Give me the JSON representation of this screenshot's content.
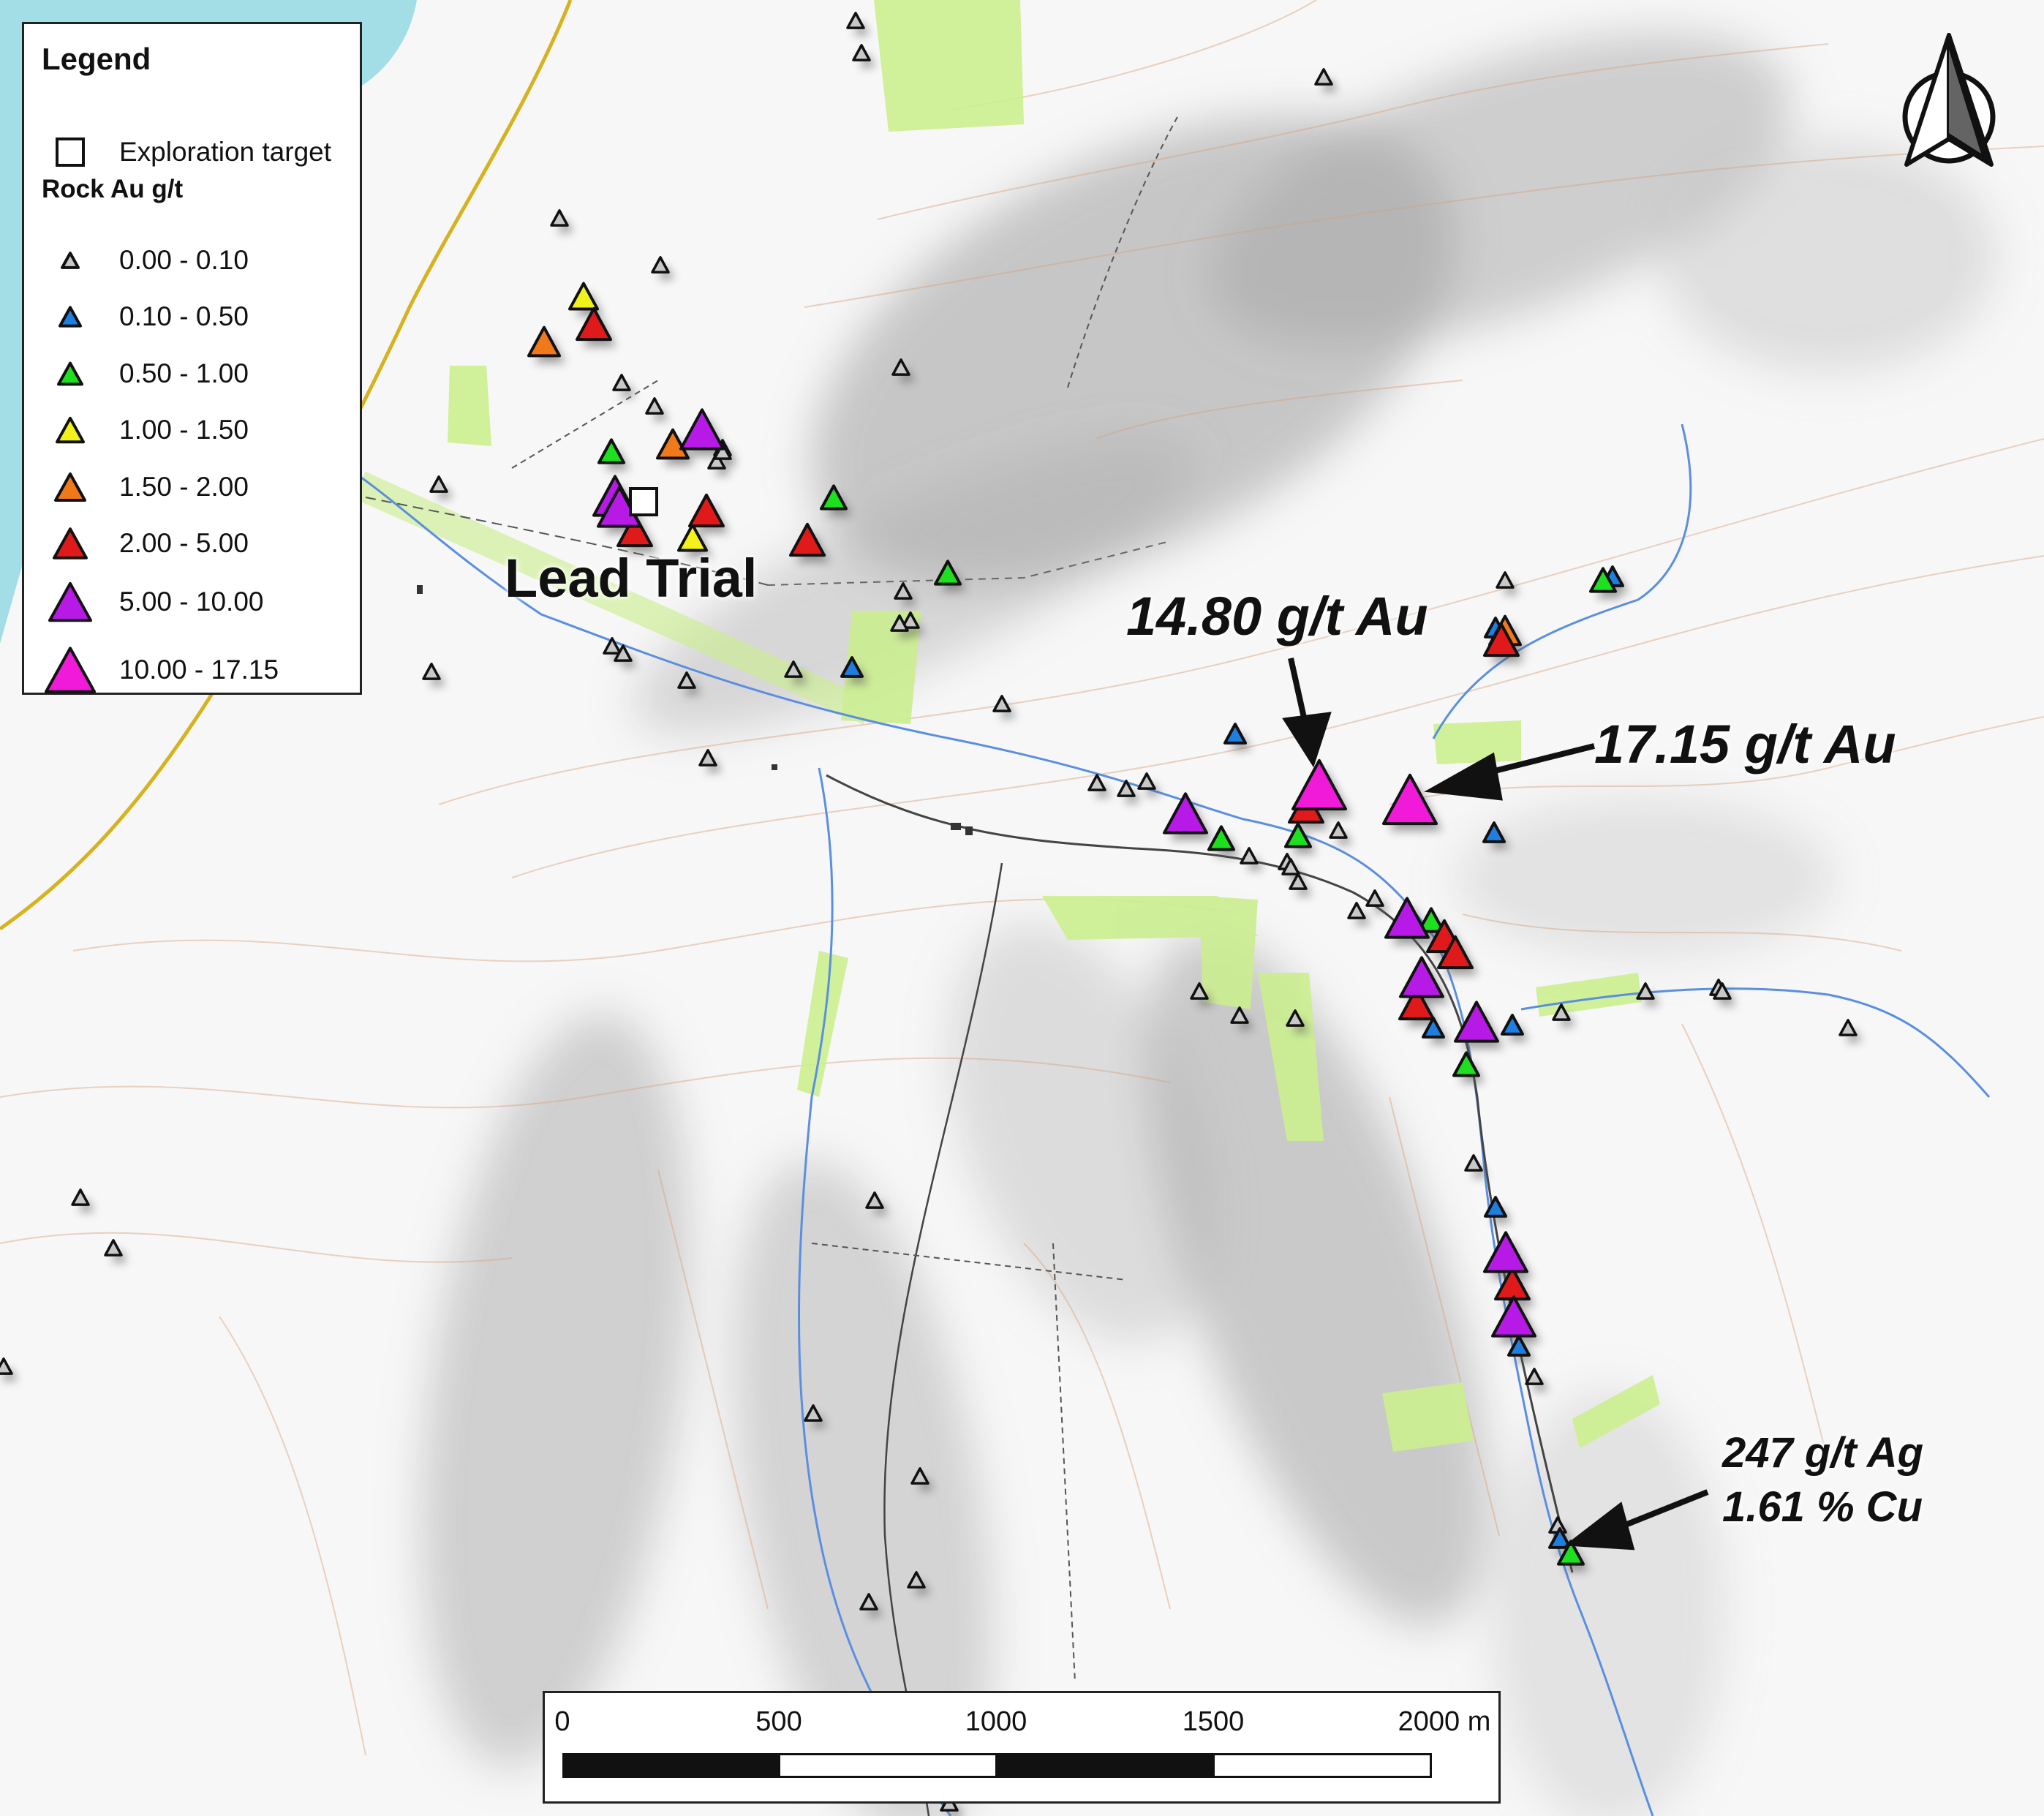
{
  "legend": {
    "title": "Legend",
    "exploration_target": "Exploration target",
    "subtitle": "Rock Au g/t",
    "classes": [
      {
        "label": "0.00 - 0.10",
        "color": "#c8c8c8"
      },
      {
        "label": "0.10 - 0.50",
        "color": "#1f7fe0"
      },
      {
        "label": "0.50 - 1.00",
        "color": "#1fe01f"
      },
      {
        "label": "1.00 - 1.50",
        "color": "#f2f21a"
      },
      {
        "label": "1.50 - 2.00",
        "color": "#f07a1a"
      },
      {
        "label": "2.00 - 5.00",
        "color": "#e01a1a"
      },
      {
        "label": "5.00 - 10.00",
        "color": "#b71ae6"
      },
      {
        "label": "10.00 - 17.15",
        "color": "#f01ad8"
      }
    ]
  },
  "labels": {
    "lead_trial": "Lead Trial",
    "callout_a": "14.80 g/t Au",
    "callout_b": "17.15 g/t Au",
    "callout_c_line1": "247 g/t Ag",
    "callout_c_line2": "1.61 % Cu"
  },
  "scale_bar": {
    "labels": [
      "0",
      "500",
      "1000",
      "1500",
      "2000 m"
    ]
  },
  "icons": {
    "north_arrow": "north-arrow-icon",
    "target_box": "square-outline-icon",
    "sample": "triangle-icon"
  }
}
